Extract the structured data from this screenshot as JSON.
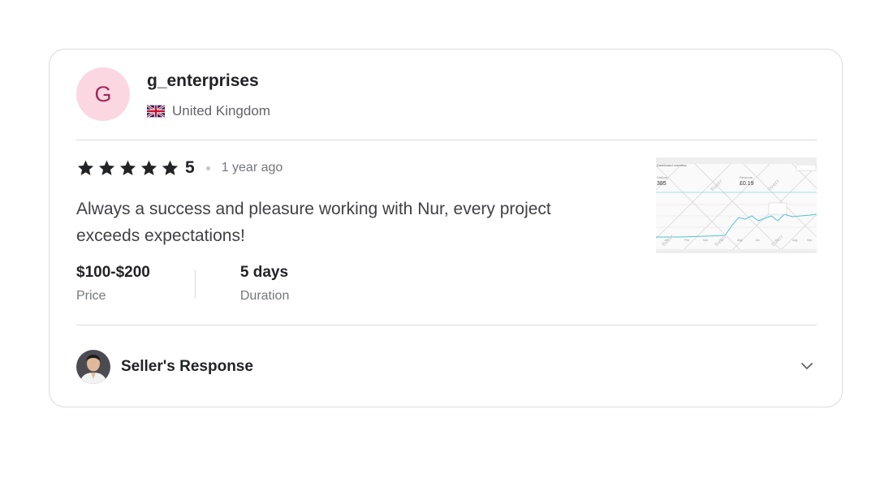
{
  "reviewer": {
    "initial": "G",
    "username": "g_enterprises",
    "country": "United Kingdom",
    "flag_icon": "uk-flag-icon"
  },
  "review": {
    "rating_value": "5",
    "stars_filled": 5,
    "time_ago": "1 year ago",
    "text": "Always a success and pleasure working with Nur, every project exceeds expectations!"
  },
  "meta": {
    "price_value": "$100-$200",
    "price_label": "Price",
    "duration_value": "5 days",
    "duration_label": "Duration"
  },
  "response": {
    "title": "Seller's Response",
    "toggle_icon": "chevron-down-icon"
  },
  "thumbnail": {
    "stat_left": "385",
    "stat_right": "£0.19",
    "watermark": "fiverr"
  },
  "colors": {
    "avatar_bg": "#fbd7e1",
    "avatar_text": "#a0285a",
    "star": "#222325",
    "chart_line": "#4ec4d0"
  }
}
